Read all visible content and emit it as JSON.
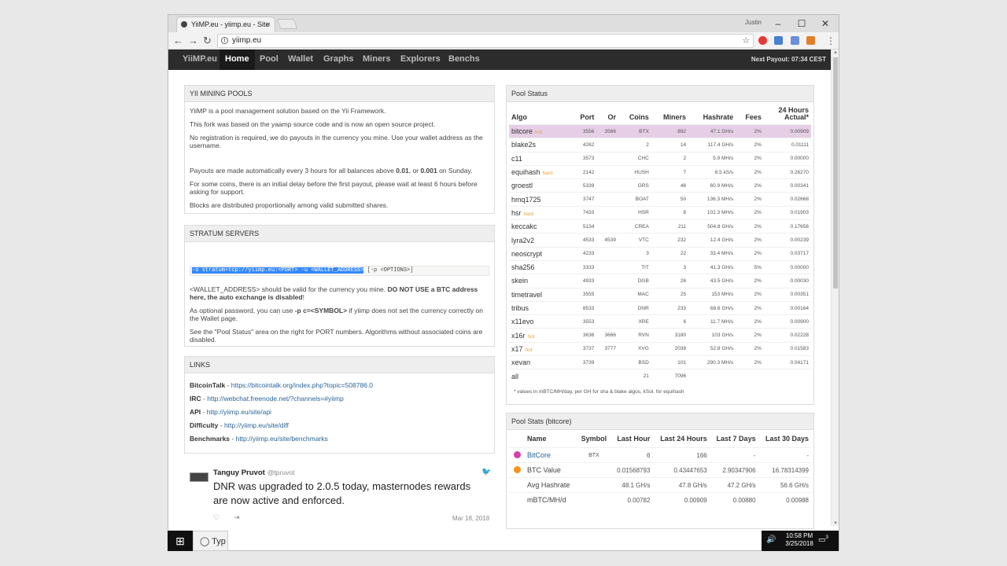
{
  "browser": {
    "tab_title": "YiiMP.eu - yiimp.eu - Site",
    "tab_close": "×",
    "user": "Justin",
    "url": "yiimp.eu"
  },
  "navbar": {
    "brand": "YiiMP.eu",
    "items": [
      "Home",
      "Pool",
      "Wallet",
      "Graphs",
      "Miners",
      "Explorers",
      "Benchs"
    ],
    "active": "Home",
    "next_payout": "Next Payout: 07:34 CEST"
  },
  "mining_pools": {
    "title": "YII MINING POOLS",
    "p1": "YiiMP is a pool management solution based on the Yii Framework.",
    "p2": "This fork was based on the yaamp source code and is now an open source project.",
    "p3": "No registration is required, we do payouts in the currency you mine. Use your wallet address as the username.",
    "p4a": "Payouts are made automatically every 3 hours for all balances above ",
    "p4b": "0.01",
    "p4c": ", or ",
    "p4d": "0.001",
    "p4e": " on Sunday.",
    "p5": "For some coins, there is an initial delay before the first payout, please wait at least 6 hours before asking for support.",
    "p6": "Blocks are distributed proportionally among valid submitted shares."
  },
  "stratum": {
    "title": "STRATUM SERVERS",
    "code_selected": "-o stratum+tcp://yiimp.eu:<PORT> -u <WALLET_ADDRESS>",
    "code_rest": " [-p <OPTIONS>]",
    "p1a": "<WALLET_ADDRESS> should be valid for the currency you mine. ",
    "p1b": "DO NOT USE a BTC address here, the auto exchange is disabled",
    "p1c": "!",
    "p2a": "As optional password, you can use ",
    "p2b": "-p c=<SYMBOL>",
    "p2c": " if yiimp does not set the currency correctly on the Wallet page.",
    "p3": "See the \"Pool Status\" area on the right for PORT numbers. Algorithms without associated coins are disabled."
  },
  "links": {
    "title": "LINKS",
    "items": [
      {
        "label": "BitcoinTalk",
        "sep": " - ",
        "url": "https://bitcointalk.org/index.php?topic=508786.0"
      },
      {
        "label": "IRC",
        "sep": " - ",
        "url": "http://webchat.freenode.net/?channels=#yiimp"
      },
      {
        "label": "API",
        "sep": " - ",
        "url": "http://yiimp.eu/site/api"
      },
      {
        "label": "Difficulty",
        "sep": " - ",
        "url": "http://yiimp.eu/site/diff"
      },
      {
        "label": "Benchmarks",
        "sep": " - ",
        "url": "http://yiimp.eu/site/benchmarks"
      }
    ]
  },
  "tweet": {
    "name": "Tanguy Pruvot",
    "handle": "@tpruvot",
    "text": "DNR was upgraded to 2.0.5 today, masternodes rewards are now active and enforced.",
    "date": "Mar 18, 2018"
  },
  "pool_status": {
    "title": "Pool Status",
    "headers": [
      "Algo",
      "Port",
      "Or",
      "Coins",
      "Miners",
      "Hashrate",
      "Fees",
      "24 Hours",
      "Actual*"
    ],
    "rows": [
      {
        "algo": "bitcore",
        "tag": "hot",
        "port": "3556",
        "or": "3566",
        "coins": "BTX",
        "miners": "892",
        "hashrate": "47.1 GH/s",
        "fees": "2%",
        "actual": "0.00909"
      },
      {
        "algo": "blake2s",
        "tag": "",
        "port": "4262",
        "or": "",
        "coins": "2",
        "miners": "14",
        "hashrate": "117.4 GH/s",
        "fees": "2%",
        "actual": "0.01111"
      },
      {
        "algo": "c11",
        "tag": "",
        "port": "3573",
        "or": "",
        "coins": "CHC",
        "miners": "2",
        "hashrate": "5.9 MH/s",
        "fees": "2%",
        "actual": "0.00000"
      },
      {
        "algo": "equihash",
        "tag": "hard",
        "port": "2142",
        "or": "",
        "coins": "HUSH",
        "miners": "7",
        "hashrate": "8.5 kS/s",
        "fees": "2%",
        "actual": "0.26270"
      },
      {
        "algo": "groestl",
        "tag": "",
        "port": "5339",
        "or": "",
        "coins": "GRS",
        "miners": "46",
        "hashrate": "60.9 MH/s",
        "fees": "2%",
        "actual": "0.00341"
      },
      {
        "algo": "hmq1725",
        "tag": "",
        "port": "3747",
        "or": "",
        "coins": "BOAT",
        "miners": "50",
        "hashrate": "136.3 MH/s",
        "fees": "2%",
        "actual": "0.02668"
      },
      {
        "algo": "hsr",
        "tag": "hard",
        "port": "7433",
        "or": "",
        "coins": "HSR",
        "miners": "8",
        "hashrate": "102.3 MH/s",
        "fees": "2%",
        "actual": "0.01903"
      },
      {
        "algo": "keccakc",
        "tag": "",
        "port": "5134",
        "or": "",
        "coins": "CREA",
        "miners": "211",
        "hashrate": "504.8 GH/s",
        "fees": "2%",
        "actual": "0.17656"
      },
      {
        "algo": "lyra2v2",
        "tag": "",
        "port": "4533",
        "or": "4539",
        "coins": "VTC",
        "miners": "232",
        "hashrate": "12.4 GH/s",
        "fees": "2%",
        "actual": "0.00239"
      },
      {
        "algo": "neoscrypt",
        "tag": "",
        "port": "4233",
        "or": "",
        "coins": "3",
        "miners": "22",
        "hashrate": "33.4 MH/s",
        "fees": "2%",
        "actual": "0.03717"
      },
      {
        "algo": "sha256",
        "tag": "",
        "port": "3333",
        "or": "",
        "coins": "TIT",
        "miners": "3",
        "hashrate": "41.3 GH/s",
        "fees": "5%",
        "actual": "0.00000"
      },
      {
        "algo": "skein",
        "tag": "",
        "port": "4933",
        "or": "",
        "coins": "DGB",
        "miners": "26",
        "hashrate": "43.5 GH/s",
        "fees": "2%",
        "actual": "0.00030"
      },
      {
        "algo": "timetravel",
        "tag": "",
        "port": "3555",
        "or": "",
        "coins": "MAC",
        "miners": "25",
        "hashrate": "153 MH/s",
        "fees": "2%",
        "actual": "0.00351"
      },
      {
        "algo": "tribus",
        "tag": "",
        "port": "8533",
        "or": "",
        "coins": "DNR",
        "miners": "233",
        "hashrate": "68.6 GH/s",
        "fees": "2%",
        "actual": "0.00164"
      },
      {
        "algo": "x11evo",
        "tag": "",
        "port": "3553",
        "or": "",
        "coins": "XRE",
        "miners": "6",
        "hashrate": "11.7 MH/s",
        "fees": "2%",
        "actual": "0.00900"
      },
      {
        "algo": "x16r",
        "tag": "hot",
        "port": "3636",
        "or": "3666",
        "coins": "RVN",
        "miners": "3180",
        "hashrate": "103 GH/s",
        "fees": "2%",
        "actual": "0.02228"
      },
      {
        "algo": "x17",
        "tag": "hot",
        "port": "3737",
        "or": "3777",
        "coins": "XVG",
        "miners": "2038",
        "hashrate": "52.8 GH/s",
        "fees": "2%",
        "actual": "0.01583"
      },
      {
        "algo": "xevan",
        "tag": "",
        "port": "3739",
        "or": "",
        "coins": "BSD",
        "miners": "101",
        "hashrate": "290.3 MH/s",
        "fees": "2%",
        "actual": "0.04171"
      },
      {
        "algo": "all",
        "tag": "",
        "port": "",
        "or": "",
        "coins": "21",
        "miners": "7096",
        "hashrate": "",
        "fees": "",
        "actual": ""
      }
    ],
    "note": "* values in mBTC/MH/day, per GH for sha & blake algos, kSol. for equihash"
  },
  "pool_stats": {
    "title": "Pool Stats (bitcore)",
    "headers": [
      "Name",
      "Symbol",
      "Last Hour",
      "Last 24 Hours",
      "Last 7 Days",
      "Last 30 Days"
    ],
    "rows": [
      {
        "icon": "bitcore-coin-icon",
        "color": "#d43fa8",
        "name": "BitCore",
        "symbol": "BTX",
        "h1": "6",
        "h24": "166",
        "d7": "-",
        "d30": "-"
      },
      {
        "icon": "bitcoin-coin-icon",
        "color": "#f7931a",
        "name": "BTC Value",
        "symbol": "",
        "h1": "0.01568793",
        "h24": "0.43447653",
        "d7": "2.90347906",
        "d30": "16.78314399"
      },
      {
        "icon": "",
        "color": "",
        "name": "Avg Hashrate",
        "symbol": "",
        "h1": "48.1 GH/s",
        "h24": "47.8 GH/s",
        "d7": "47.2 GH/s",
        "d30": "56.6 GH/s"
      },
      {
        "icon": "",
        "color": "",
        "name": "mBTC/MH/d",
        "symbol": "",
        "h1": "0.00782",
        "h24": "0.00909",
        "d7": "0.00880",
        "d30": "0.00988"
      }
    ]
  },
  "taskbar": {
    "search": "Typ",
    "time": "10:58 PM",
    "date": "3/25/2018",
    "notifications": "3"
  },
  "colors": {
    "navbar": "#2c2c2c",
    "highlight_row": "#e6cfe6",
    "tag": "#e8a33a",
    "link": "#2a6496"
  }
}
